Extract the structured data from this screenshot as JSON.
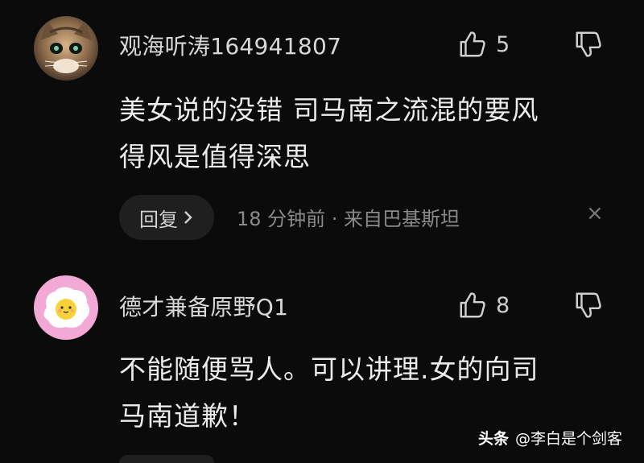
{
  "comments": [
    {
      "username": "观海听涛164941807",
      "likes": "5",
      "lines": [
        "美女说的没错 司马南之流混的要风",
        "得风是值得深思"
      ],
      "reply_label": "回复",
      "meta": "18 分钟前 · 来自巴基斯坦",
      "close_icon": "×",
      "avatar": "cat-avatar"
    },
    {
      "username": "德才兼备原野Q1",
      "likes": "8",
      "lines": [
        "不能随便骂人。可以讲理.女的向司",
        "马南道歉！"
      ],
      "avatar": "fried-egg-avatar"
    }
  ],
  "watermark": {
    "brand": "头条",
    "author": "@李白是个剑客"
  },
  "colors": {
    "background": "#0b0b0b",
    "text": "#ececec",
    "meta": "#8a8a8a",
    "avatar2_bg": "#f2a9d6"
  }
}
